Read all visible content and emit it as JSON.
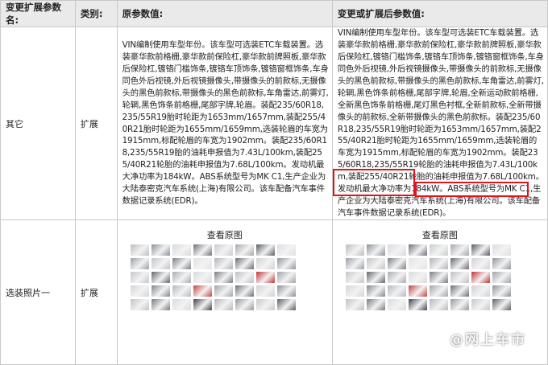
{
  "header": {
    "col1": "变更扩展参数名:",
    "col2": "类别:",
    "col3": "原参数值:",
    "col4": "变更或扩展后参数值:"
  },
  "rows": [
    {
      "name": "其它",
      "category": "扩展",
      "original": "VIN编制使用车型年份。该车型可选装ETC车载装置。选装豪华款前格栅,豪华款前保险杠,豪华款前牌照板,豪华款后保险杠,镀铬门槛饰条,镀铬车顶饰条,镀铬窗框饰条,车身同色外后视镜,外后视镜摄像头,带摄像头的前款标,无摄像头的黑色前款标,带摄像头的黑色前款标,车角雷达,前雾灯,轮辋,黑色饰条前格栅,尾部字牌,轮眉。装配235/60R18,235/55R19胎时轮距为1653mm/1657mm,装配255/40R21胎时轮距为1655mm/1659mm,选装轮眉的车宽为1915mm,标配轮眉的车宽为1902mm。装配235/60R18,235/55R19胎的油耗申报值为7.43L/100km,装配255/40R21轮胎的油耗申报值为7.68L/100km。发动机最大净功率为184kW。ABS系统型号为MK C1,生产企业为大陆泰密克汽车系统(上海)有限公司。该车配备汽车事件数据记录系统(EDR)。",
      "changed": "VIN编制使用车型年份。该车型可选装ETC车载装置。选装豪华款前格栅,豪华款前保险杠,豪华款前牌照板,豪华款后保险杠,镀铬门槛饰条,镀铬车顶饰条,镀铬窗框饰条,车身同色外后视镜,外后视镜摄像头,带摄像头的前款标,无摄像头的黑色前款标,带摄像头的黑色前款标,车角雷达,前雾灯,轮辋,黑色饰条前格栅,尾部字牌,轮眉,全新运动款前格栅,全新黑色饰条前格栅,尾灯黑色衬框,全新前款标,全新带摄像头的前款标,全新带摄像头的黑色前款标。装配235/60R18,235/55R19胎时轮距为1653mm/1657mm,装配255/40R21胎时轮距为1655mm/1659mm,选装轮眉的车宽为1915mm,标配轮眉的车宽为1902mm。装配235/60R18,235/55R19轮胎的油耗申报值为7.43L/100km,装配255/40R21轮胎的油耗申报值为7.68L/100km。发动机最大净功率为184kW。ABS系统型号为MK C1,生产企业为大陆泰密克汽车系统(上海)有限公司。该车配备汽车事件数据记录系统(EDR)。"
    },
    {
      "name": "选装照片一",
      "category": "扩展",
      "original_link": "查看原图",
      "changed_link": "查看原图"
    }
  ],
  "watermark": "@网上车市",
  "highlight_color": "#e0141e",
  "thumb_colors": [
    "#b9bcc2",
    "#8a8f99",
    "#d7d9dc",
    "#6d7079",
    "#c9cbcf",
    "#a4a7ad",
    "#555a63",
    "#dcdde0",
    "#9aa0a8",
    "#c2c4c8",
    "#7b7f88",
    "#e2e3e5",
    "#b0b3b8",
    "#666a72",
    "#d0d2d5",
    "#8e939b",
    "#c4c6ca",
    "#5f636b",
    "#a9acb2",
    "#d9dadd",
    "#777b83",
    "#bdbfc3",
    "#c23030",
    "#9ea2a9",
    "#d3d5d8",
    "#82868e",
    "#b5b8bd",
    "#c84040",
    "#a0a4ab",
    "#6a6e76",
    "#cfd1d4",
    "#8c9098",
    "#c0c2c6",
    "#767a82",
    "#dadbde",
    "#3d4149",
    "#b3b6bb",
    "#93979e",
    "#c6c8cc",
    "#5a5e66"
  ]
}
